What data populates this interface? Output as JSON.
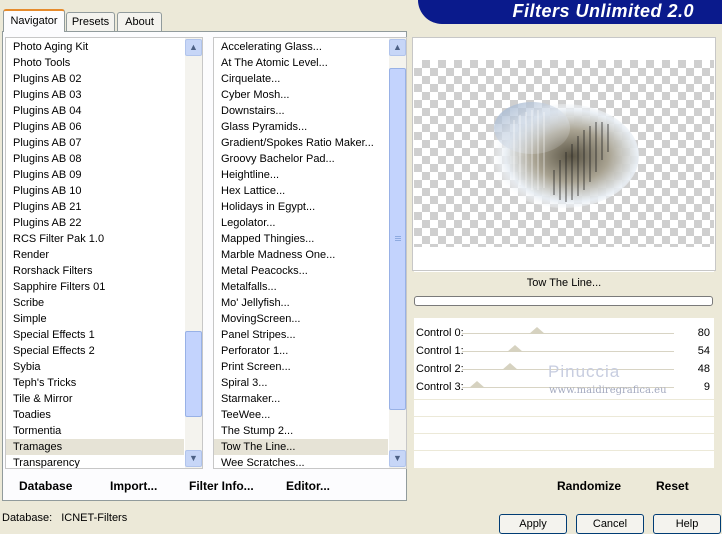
{
  "tabs": [
    "Navigator",
    "Presets",
    "About"
  ],
  "banner_title": "Filters Unlimited 2.0",
  "categories": [
    "Photo Aging Kit",
    "Photo Tools",
    "Plugins AB 02",
    "Plugins AB 03",
    "Plugins AB 04",
    "Plugins AB 06",
    "Plugins AB 07",
    "Plugins AB 08",
    "Plugins AB 09",
    "Plugins AB 10",
    "Plugins AB 21",
    "Plugins AB 22",
    "RCS Filter Pak 1.0",
    "Render",
    "Rorshack Filters",
    "Sapphire Filters 01",
    "Scribe",
    "Simple",
    "Special Effects 1",
    "Special Effects 2",
    "Sybia",
    "Teph's Tricks",
    "Tile & Mirror",
    "Toadies",
    "Tormentia",
    "Tramages",
    "Transparency"
  ],
  "selected_category": "Tramages",
  "filters": [
    "Accelerating Glass...",
    "At The Atomic Level...",
    "Cirquelate...",
    "Cyber Mosh...",
    "Downstairs...",
    "Glass Pyramids...",
    "Gradient/Spokes Ratio Maker...",
    "Groovy Bachelor Pad...",
    "Heightline...",
    "Hex Lattice...",
    "Holidays in Egypt...",
    "Legolator...",
    "Mapped Thingies...",
    "Marble Madness One...",
    "Metal Peacocks...",
    "Metalfalls...",
    "Mo' Jellyfish...",
    "MovingScreen...",
    "Panel Stripes...",
    "Perforator 1...",
    "Print Screen...",
    "Spiral 3...",
    "Starmaker...",
    "TeeWee...",
    "The Stump 2...",
    "Tow The Line...",
    "Wee Scratches..."
  ],
  "selected_filter": "Tow The Line...",
  "filter_name": "Tow The Line...",
  "buttons": {
    "database": "Database",
    "import": "Import...",
    "filter_info": "Filter Info...",
    "editor": "Editor...",
    "randomize": "Randomize",
    "reset": "Reset",
    "apply": "Apply",
    "cancel": "Cancel",
    "help": "Help"
  },
  "controls": [
    {
      "label": "Control 0:",
      "value": "80",
      "level": 80
    },
    {
      "label": "Control 1:",
      "value": "54",
      "level": 54
    },
    {
      "label": "Control 2:",
      "value": "48",
      "level": 48
    },
    {
      "label": "Control 3:",
      "value": "9",
      "level": 9
    }
  ],
  "watermark": {
    "line1": "Pinuccia",
    "line2": "www.maidiregrafica.eu"
  },
  "status": {
    "label": "Database:",
    "value": "ICNET-Filters"
  }
}
